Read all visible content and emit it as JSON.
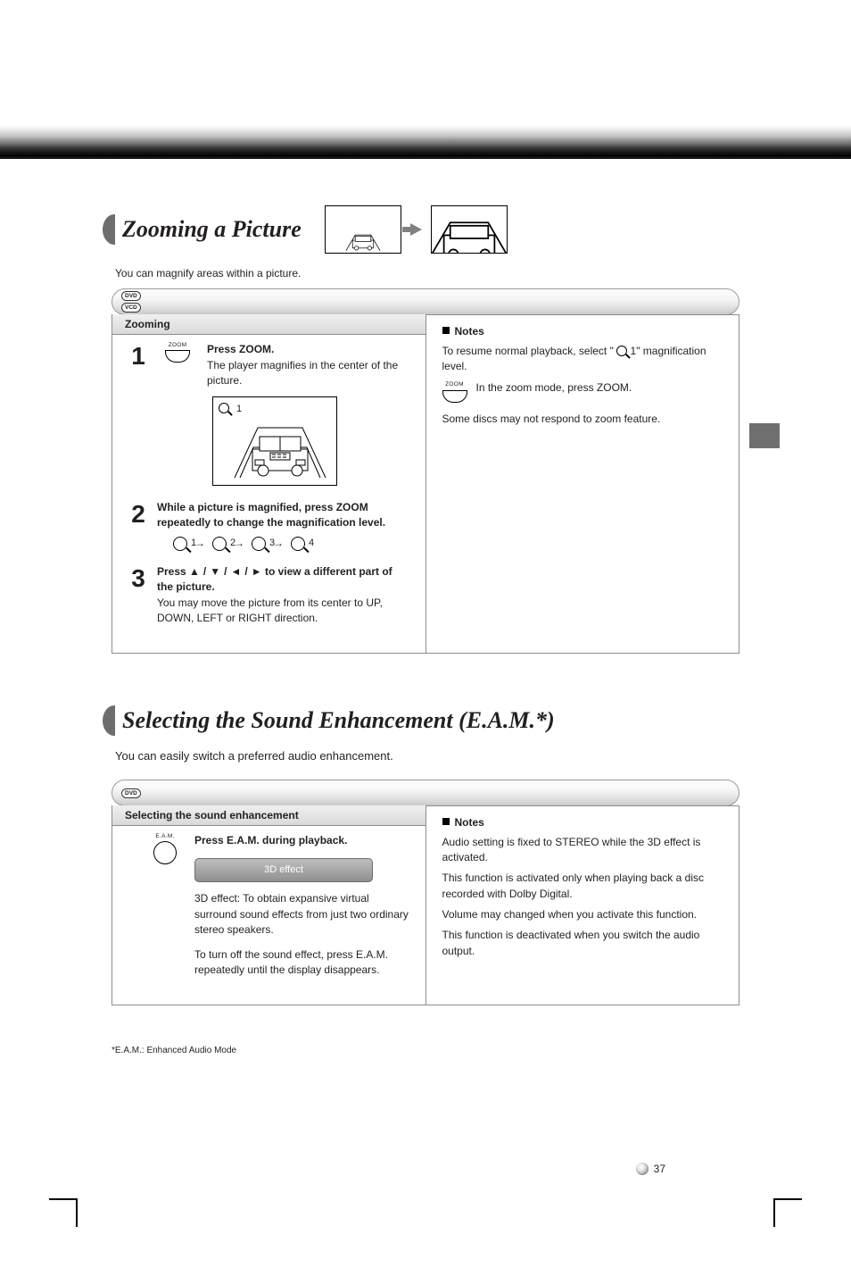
{
  "page_number": "37",
  "section1": {
    "title": "Zooming a Picture",
    "intro": "You can magnify areas within a picture.",
    "format_badges": [
      "DVD",
      "VCD"
    ],
    "left_header": "Zooming",
    "steps": {
      "s1": {
        "num": "1",
        "btn_label": "ZOOM",
        "text": "Press ZOOM.",
        "sub": "The player magnifies in the center of the picture.",
        "screen_label": "1"
      },
      "s2": {
        "num": "2",
        "text_a": "While a picture is magnified, press ZOOM repeatedly to change the magnification level.",
        "seq": [
          "1",
          "2",
          "3",
          "4"
        ]
      },
      "s3": {
        "num": "3",
        "text_a": "Press ",
        "text_b": " to view a different part of the picture.",
        "sub": "You may move the picture from its center to UP, DOWN, LEFT or RIGHT direction.",
        "arrow_glyphs": [
          "▲",
          "▼",
          "◄",
          "►"
        ],
        "slash": " / "
      }
    },
    "notes_header": "Notes",
    "note1_a": "To resume normal playback, select \"",
    "note1_b": "1\" magnification level.",
    "note2": "In the zoom mode, press ZOOM.",
    "note3": "Some discs may not respond to zoom feature.",
    "right_btn_label": "ZOOM"
  },
  "section2": {
    "title": "Selecting the Sound Enhancement (E.A.M.*)",
    "subtitle": "You can easily switch a preferred audio enhancement.",
    "format_badges": [
      "DVD"
    ],
    "left_header": "Selecting the sound enhancement",
    "btn_label": "E.A.M.",
    "osd_label": "3D  effect",
    "step_text": "Press E.A.M. during playback.",
    "mode_3d": "3D effect: To obtain expansive virtual surround sound effects from just two ordinary stereo speakers.",
    "turn_off_a": "To turn off the sound effect, press E.A.M. repeatedly until the display disappears.",
    "notes_header": "Notes",
    "note1": "Audio setting is fixed to STEREO while the 3D effect is activated.",
    "note2": "This function is activated only when playing back a disc recorded with Dolby Digital.",
    "note3": "Volume may changed when you activate this function.",
    "note4": "This function is deactivated when you switch the audio output."
  },
  "footnote": "*E.A.M.: Enhanced Audio Mode"
}
